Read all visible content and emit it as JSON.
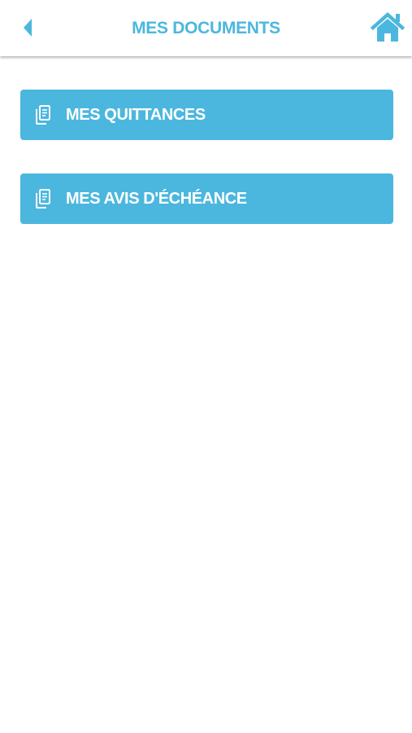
{
  "header": {
    "title": "MES DOCUMENTS",
    "back_icon": "chevron-left-icon",
    "home_icon": "home-icon"
  },
  "documents": {
    "items": [
      {
        "label": "MES QUITTANCES",
        "icon": "documents-icon"
      },
      {
        "label": "MES AVIS D'ÉCHÉANCE",
        "icon": "documents-icon"
      }
    ]
  },
  "colors": {
    "accent": "#4bb7de",
    "button_text": "#ffffff",
    "background": "#ffffff"
  }
}
